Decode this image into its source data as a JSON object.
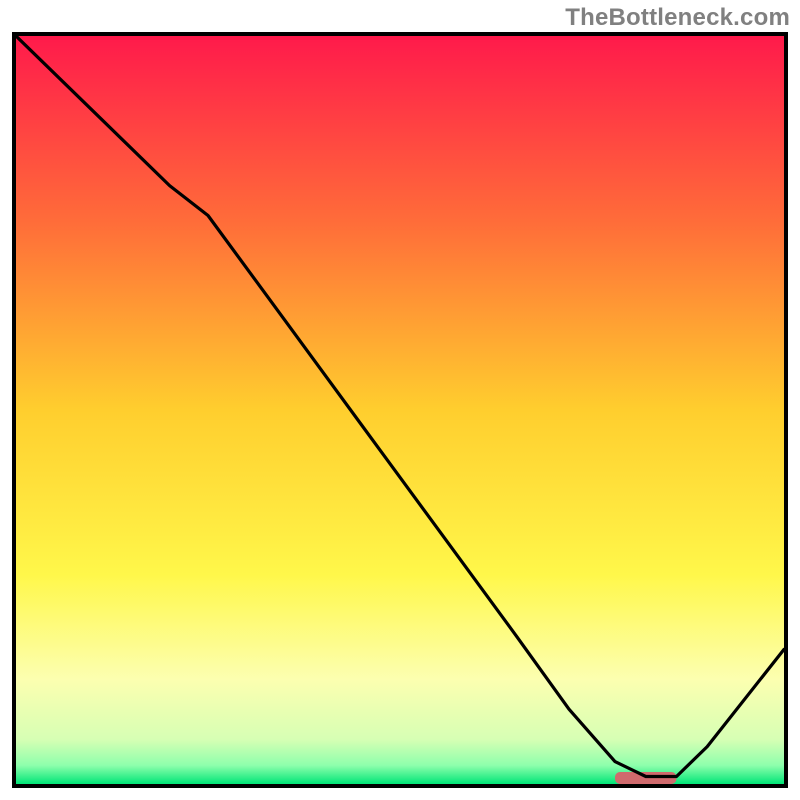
{
  "watermark": "TheBottleneck.com",
  "chart_data": {
    "type": "line",
    "title": "",
    "xlabel": "",
    "ylabel": "",
    "xlim": [
      0,
      100
    ],
    "ylim": [
      0,
      100
    ],
    "x": [
      0,
      10,
      20,
      25,
      35,
      45,
      55,
      65,
      72,
      78,
      82,
      86,
      90,
      100
    ],
    "values": [
      100,
      90,
      80,
      76,
      62,
      48,
      34,
      20,
      10,
      3,
      1,
      1,
      5,
      18
    ],
    "marker": {
      "x_range": [
        78,
        86
      ],
      "y": 0.8,
      "color": "#cf6a6d"
    },
    "gradient_stops": [
      {
        "offset": 0.0,
        "color": "#ff1a4b"
      },
      {
        "offset": 0.25,
        "color": "#ff6d39"
      },
      {
        "offset": 0.5,
        "color": "#ffce2e"
      },
      {
        "offset": 0.72,
        "color": "#fff74a"
      },
      {
        "offset": 0.86,
        "color": "#fcffb0"
      },
      {
        "offset": 0.94,
        "color": "#d7ffb4"
      },
      {
        "offset": 0.975,
        "color": "#8effac"
      },
      {
        "offset": 1.0,
        "color": "#00e577"
      }
    ]
  }
}
